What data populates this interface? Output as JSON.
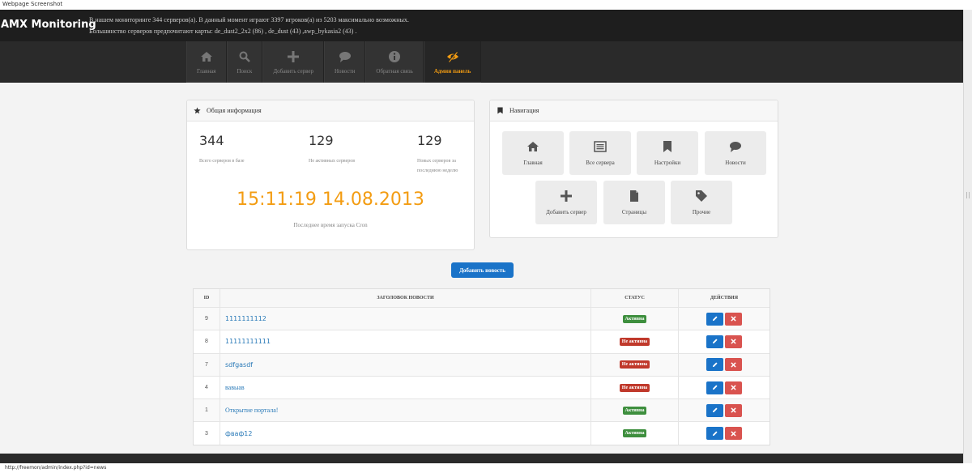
{
  "window": {
    "caption": "Webpage Screenshot"
  },
  "header": {
    "brand": "AMX Monitoring",
    "info_line1": "В нашем мониторинге 344 серверов(а). В данный момент играют 3397 игроков(а) из 5203 максимально возможных.",
    "info_line2": "Большинство серверов предпочитают карты: de_dust2_2x2 (86) , de_dust (43) ,awp_bykasia2 (43) ."
  },
  "nav": {
    "items": [
      {
        "label": "Главная",
        "icon": "home-icon"
      },
      {
        "label": "Поиск",
        "icon": "search-icon"
      },
      {
        "label": "Добавить сервер",
        "icon": "plus-icon"
      },
      {
        "label": "Новости",
        "icon": "comment-icon"
      },
      {
        "label": "Обратная связь",
        "icon": "info-icon"
      },
      {
        "label": "Админ панель",
        "icon": "eye-slash-icon",
        "active": true
      }
    ]
  },
  "info_panel": {
    "title": "Общая информация",
    "stats": [
      {
        "value": "344",
        "caption": "Всего серверов в базе"
      },
      {
        "value": "129",
        "caption": "Не активных серверов"
      },
      {
        "value": "129",
        "caption": "Новых серверов за последнюю неделю"
      }
    ],
    "clock": "15:11:19 14.08.2013",
    "clock_caption": "Последнее время запуска Cron"
  },
  "nav_panel": {
    "title": "Навигация",
    "tiles": [
      {
        "label": "Главная",
        "icon": "home-icon"
      },
      {
        "label": "Все сервера",
        "icon": "list-icon"
      },
      {
        "label": "Настройки",
        "icon": "bookmark-icon"
      },
      {
        "label": "Новости",
        "icon": "comment-icon"
      },
      {
        "label": "Добавить сервер",
        "icon": "plus-icon"
      },
      {
        "label": "Страницы",
        "icon": "file-icon"
      },
      {
        "label": "Прочие",
        "icon": "tag-icon"
      }
    ]
  },
  "add_news_label": "Добавить новость",
  "table": {
    "headers": {
      "id": "ID",
      "title": "ЗАГОЛОВОК НОВОСТИ",
      "status": "СТАТУС",
      "actions": "ДЕЙСТВИЯ"
    },
    "rows": [
      {
        "id": "9",
        "title": "1111111112",
        "status": "Активна",
        "active": true
      },
      {
        "id": "8",
        "title": "11111111111",
        "status": "Не активна",
        "active": false
      },
      {
        "id": "7",
        "title": "sdfgasdf",
        "status": "Не активна",
        "active": false
      },
      {
        "id": "4",
        "title": "вавыав",
        "status": "Не активна",
        "active": false
      },
      {
        "id": "1",
        "title": "Открытие портала!",
        "status": "Активна",
        "active": true
      },
      {
        "id": "3",
        "title": "фваф12",
        "status": "Активна",
        "active": true
      }
    ]
  },
  "statusbar": {
    "url": "http://freemon/admin/index.php?id=news"
  },
  "colors": {
    "accent": "#f39c12",
    "primary": "#1a73c8",
    "danger": "#d9534f",
    "success": "#3e8f3e"
  }
}
